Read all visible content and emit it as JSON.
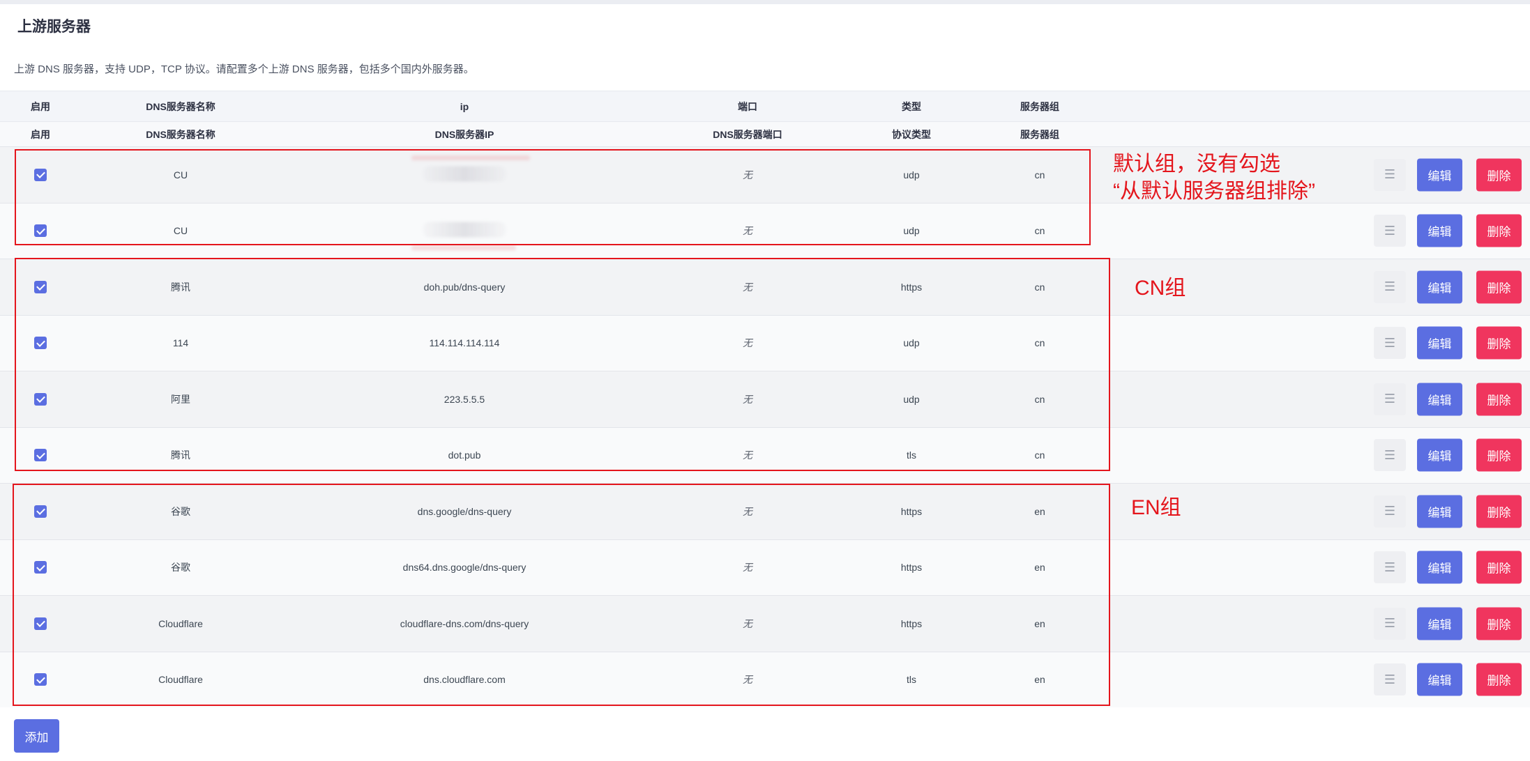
{
  "page": {
    "title": "上游服务器",
    "description": "上游 DNS 服务器，支持 UDP，TCP 协议。请配置多个上游 DNS 服务器，包括多个国内外服务器。"
  },
  "table": {
    "header_primary": [
      "启用",
      "DNS服务器名称",
      "ip",
      "端口",
      "类型",
      "服务器组"
    ],
    "header_secondary": [
      "启用",
      "DNS服务器名称",
      "DNS服务器IP",
      "DNS服务器端口",
      "协议类型",
      "服务器组"
    ],
    "rows": [
      {
        "enabled": true,
        "name": "CU",
        "ip": "",
        "ip_redacted": true,
        "port": "无",
        "type": "udp",
        "group": "cn"
      },
      {
        "enabled": true,
        "name": "CU",
        "ip": "",
        "ip_redacted": true,
        "port": "无",
        "type": "udp",
        "group": "cn"
      },
      {
        "enabled": true,
        "name": "腾讯",
        "ip": "doh.pub/dns-query",
        "port": "无",
        "type": "https",
        "group": "cn"
      },
      {
        "enabled": true,
        "name": "114",
        "ip": "114.114.114.114",
        "port": "无",
        "type": "udp",
        "group": "cn"
      },
      {
        "enabled": true,
        "name": "阿里",
        "ip": "223.5.5.5",
        "port": "无",
        "type": "udp",
        "group": "cn"
      },
      {
        "enabled": true,
        "name": "腾讯",
        "ip": "dot.pub",
        "port": "无",
        "type": "tls",
        "group": "cn"
      },
      {
        "enabled": true,
        "name": "谷歌",
        "ip": "dns.google/dns-query",
        "port": "无",
        "type": "https",
        "group": "en"
      },
      {
        "enabled": true,
        "name": "谷歌",
        "ip": "dns64.dns.google/dns-query",
        "port": "无",
        "type": "https",
        "group": "en"
      },
      {
        "enabled": true,
        "name": "Cloudflare",
        "ip": "cloudflare-dns.com/dns-query",
        "port": "无",
        "type": "https",
        "group": "en"
      },
      {
        "enabled": true,
        "name": "Cloudflare",
        "ip": "dns.cloudflare.com",
        "port": "无",
        "type": "tls",
        "group": "en"
      }
    ]
  },
  "actions": {
    "drag_icon": "hamburger-icon",
    "edit_label": "编辑",
    "delete_label": "删除",
    "add_label": "添加"
  },
  "annotations": {
    "default_group": [
      "默认组，没有勾选",
      "“从默认服务器组排除”"
    ],
    "cn_group": "CN组",
    "en_group": "EN组"
  },
  "colors": {
    "primary": "#5b6ee1",
    "danger": "#f0355e",
    "annotation_red": "#e4151c"
  }
}
